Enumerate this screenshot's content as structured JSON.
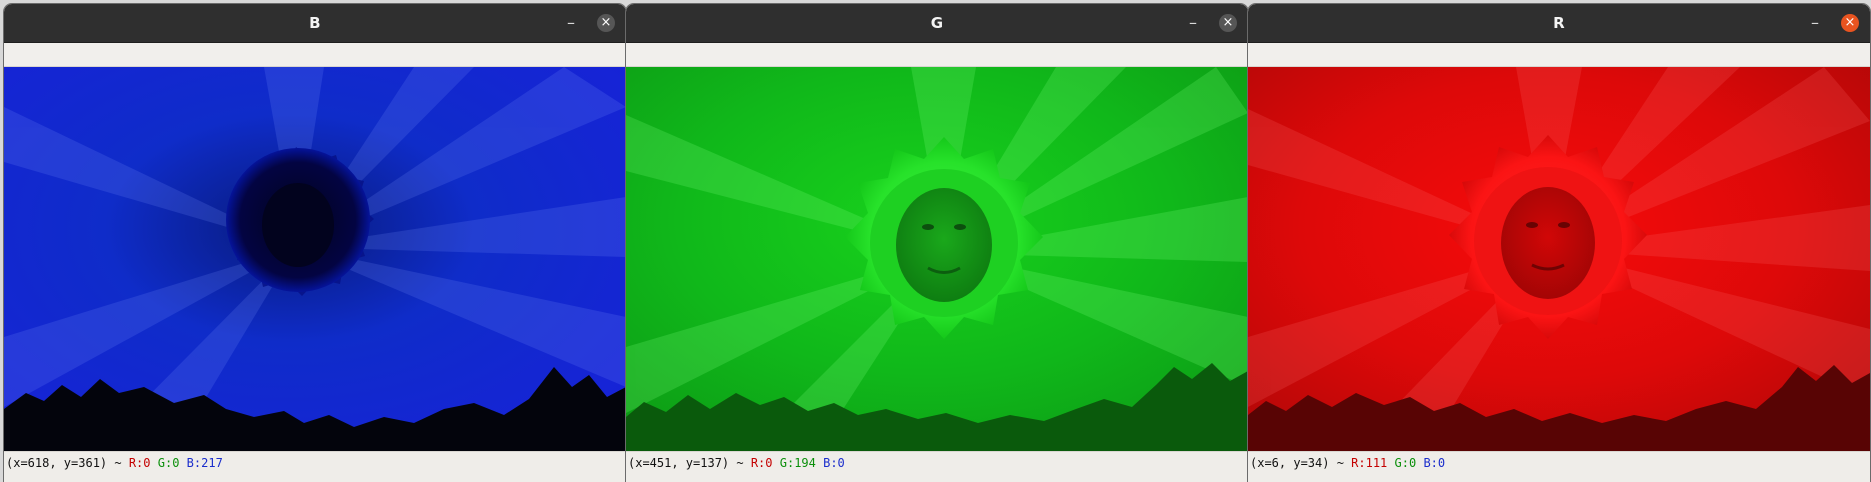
{
  "windows": [
    {
      "id": "b",
      "title": "B",
      "channel_color": "#1b1bd8",
      "close_style": "normal",
      "status": {
        "coords": "(x=618, y=361) ~",
        "r": "R:0",
        "g": "G:0",
        "b": "B:217"
      }
    },
    {
      "id": "g",
      "title": "G",
      "channel_color": "#17d61b",
      "close_style": "normal",
      "status": {
        "coords": "(x=451, y=137) ~",
        "r": "R:0",
        "g": "G:194",
        "b": "B:0"
      }
    },
    {
      "id": "r",
      "title": "R",
      "channel_color": "#e80d0d",
      "close_style": "active",
      "status": {
        "coords": "(x=6, y=34) ~",
        "r": "R:111",
        "g": "G:0",
        "b": "B:0"
      }
    }
  ],
  "controls": {
    "minimize_glyph": "–",
    "close_glyph": "×"
  },
  "icons": {
    "minimize": "minimize-icon",
    "close": "close-icon"
  }
}
